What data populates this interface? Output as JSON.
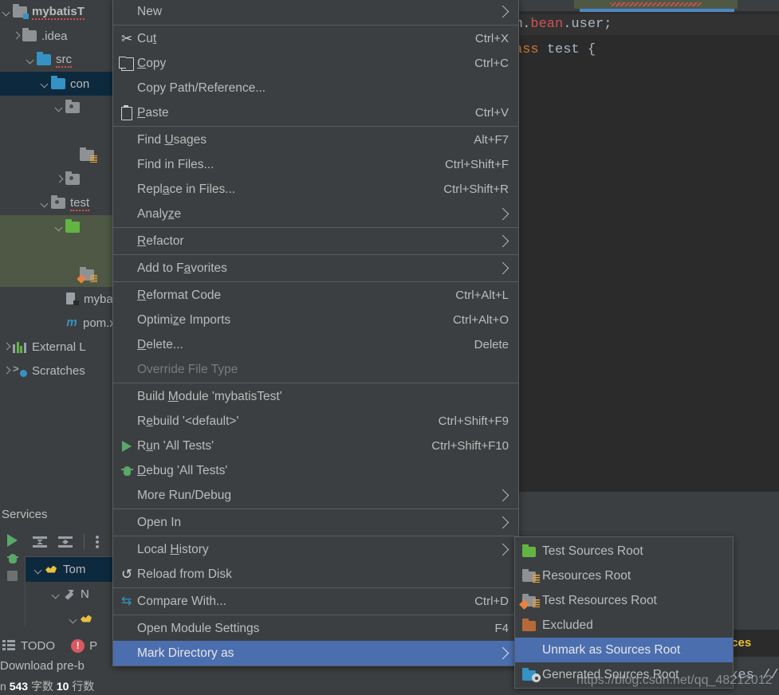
{
  "project_tree": {
    "items": [
      {
        "label": "mybatisT",
        "icon": "module-folder-icon",
        "indent": 0,
        "arrow": "down",
        "bold": true,
        "squiggle": true,
        "folder": "grey",
        "badge": "cyan",
        "state": "normal"
      },
      {
        "label": ".idea",
        "icon": "folder-icon",
        "indent": 1,
        "arrow": "right",
        "bold": false,
        "squiggle": false,
        "folder": "grey",
        "badge": "",
        "state": "normal"
      },
      {
        "label": "src",
        "icon": "folder-icon",
        "indent": 2,
        "arrow": "down",
        "bold": false,
        "squiggle": true,
        "folder": "blue",
        "badge": "",
        "state": "normal"
      },
      {
        "label": "con",
        "icon": "folder-icon",
        "indent": 3,
        "arrow": "down",
        "bold": false,
        "squiggle": false,
        "folder": "blue",
        "badge": "",
        "state": "selected-blue"
      },
      {
        "label": "",
        "icon": "package-icon",
        "indent": 4,
        "arrow": "down",
        "bold": false,
        "squiggle": false,
        "folder": "grey-pkg",
        "badge": "",
        "state": "normal"
      },
      {
        "label": "",
        "icon": "class-icon",
        "indent": 5,
        "arrow": "none",
        "bold": false,
        "squiggle": false,
        "folder": "none",
        "badge": "",
        "state": "normal"
      },
      {
        "label": "",
        "icon": "resources-folder-icon",
        "indent": 5,
        "arrow": "none",
        "bold": false,
        "squiggle": false,
        "folder": "grey",
        "badge": "lines",
        "state": "normal"
      },
      {
        "label": "",
        "icon": "package-icon",
        "indent": 4,
        "arrow": "right",
        "bold": false,
        "squiggle": false,
        "folder": "grey-pkg",
        "badge": "",
        "state": "normal"
      },
      {
        "label": "test",
        "icon": "package-icon",
        "indent": 3,
        "arrow": "down",
        "bold": false,
        "squiggle": true,
        "folder": "grey-pkg",
        "badge": "",
        "state": "normal"
      },
      {
        "label": "",
        "icon": "test-sources-folder-icon",
        "indent": 4,
        "arrow": "down",
        "bold": false,
        "squiggle": false,
        "folder": "green",
        "badge": "",
        "state": "selected-green"
      },
      {
        "label": "",
        "icon": "class-icon",
        "indent": 5,
        "arrow": "none",
        "bold": false,
        "squiggle": false,
        "folder": "none",
        "badge": "",
        "state": "selected-green"
      },
      {
        "label": "",
        "icon": "test-resources-folder-icon",
        "indent": 5,
        "arrow": "none",
        "bold": false,
        "squiggle": false,
        "folder": "grey",
        "badge": "test-res",
        "state": "selected-green"
      },
      {
        "label": "mybat",
        "icon": "module-file-icon",
        "indent": 4,
        "arrow": "none",
        "bold": false,
        "squiggle": false,
        "folder": "none",
        "badge": "",
        "state": "normal"
      },
      {
        "label": "pom.x",
        "icon": "maven-icon",
        "indent": 4,
        "arrow": "none",
        "bold": false,
        "squiggle": false,
        "folder": "none",
        "badge": "",
        "state": "normal"
      },
      {
        "label": "External L",
        "icon": "library-icon",
        "indent": 0,
        "arrow": "right",
        "bold": false,
        "squiggle": false,
        "folder": "none",
        "badge": "",
        "state": "normal"
      },
      {
        "label": "Scratches",
        "icon": "scratches-icon",
        "indent": 0,
        "arrow": "right",
        "bold": false,
        "squiggle": false,
        "folder": "none",
        "badge": "",
        "state": "normal"
      }
    ]
  },
  "editor": {
    "lines": [
      {
        "segments": [
          {
            "text": "m.",
            "cls": "c-default"
          },
          {
            "text": "bean",
            "cls": "c-pkg"
          },
          {
            "text": ".",
            "cls": "c-default"
          },
          {
            "text": "user",
            "cls": "c-ident"
          },
          {
            "text": ";",
            "cls": "c-default"
          }
        ],
        "highlight": true
      },
      {
        "segments": [
          {
            "text": "ass ",
            "cls": "c-keyword"
          },
          {
            "text": "test ",
            "cls": "c-default"
          },
          {
            "text": "{",
            "cls": "c-default"
          }
        ],
        "highlight": false
      }
    ]
  },
  "context_menu": {
    "items": [
      {
        "label": "New",
        "mnemonic": "",
        "shortcut": "",
        "icon": "",
        "submenu": true,
        "disabled": false,
        "selected": false,
        "sep_after": true
      },
      {
        "label": "Cut",
        "mnemonic": "t",
        "shortcut": "Ctrl+X",
        "icon": "cut-icon",
        "submenu": false,
        "disabled": false,
        "selected": false,
        "sep_after": false
      },
      {
        "label": "Copy",
        "mnemonic": "C",
        "shortcut": "Ctrl+C",
        "icon": "copy-icon",
        "submenu": false,
        "disabled": false,
        "selected": false,
        "sep_after": false
      },
      {
        "label": "Copy Path/Reference...",
        "mnemonic": "",
        "shortcut": "",
        "icon": "",
        "submenu": false,
        "disabled": false,
        "selected": false,
        "sep_after": false
      },
      {
        "label": "Paste",
        "mnemonic": "P",
        "shortcut": "Ctrl+V",
        "icon": "paste-icon",
        "submenu": false,
        "disabled": false,
        "selected": false,
        "sep_after": true
      },
      {
        "label": "Find Usages",
        "mnemonic": "U",
        "shortcut": "Alt+F7",
        "icon": "",
        "submenu": false,
        "disabled": false,
        "selected": false,
        "sep_after": false
      },
      {
        "label": "Find in Files...",
        "mnemonic": "",
        "shortcut": "Ctrl+Shift+F",
        "icon": "",
        "submenu": false,
        "disabled": false,
        "selected": false,
        "sep_after": false
      },
      {
        "label": "Replace in Files...",
        "mnemonic": "a",
        "shortcut": "Ctrl+Shift+R",
        "icon": "",
        "submenu": false,
        "disabled": false,
        "selected": false,
        "sep_after": false
      },
      {
        "label": "Analyze",
        "mnemonic": "z",
        "shortcut": "",
        "icon": "",
        "submenu": true,
        "disabled": false,
        "selected": false,
        "sep_after": true
      },
      {
        "label": "Refactor",
        "mnemonic": "R",
        "shortcut": "",
        "icon": "",
        "submenu": true,
        "disabled": false,
        "selected": false,
        "sep_after": true
      },
      {
        "label": "Add to Favorites",
        "mnemonic": "a",
        "shortcut": "",
        "icon": "",
        "submenu": true,
        "disabled": false,
        "selected": false,
        "sep_after": true
      },
      {
        "label": "Reformat Code",
        "mnemonic": "R",
        "shortcut": "Ctrl+Alt+L",
        "icon": "",
        "submenu": false,
        "disabled": false,
        "selected": false,
        "sep_after": false
      },
      {
        "label": "Optimize Imports",
        "mnemonic": "z",
        "shortcut": "Ctrl+Alt+O",
        "icon": "",
        "submenu": false,
        "disabled": false,
        "selected": false,
        "sep_after": false
      },
      {
        "label": "Delete...",
        "mnemonic": "D",
        "shortcut": "Delete",
        "icon": "",
        "submenu": false,
        "disabled": false,
        "selected": false,
        "sep_after": false
      },
      {
        "label": "Override File Type",
        "mnemonic": "",
        "shortcut": "",
        "icon": "",
        "submenu": false,
        "disabled": true,
        "selected": false,
        "sep_after": true
      },
      {
        "label": "Build Module 'mybatisTest'",
        "mnemonic": "M",
        "shortcut": "",
        "icon": "",
        "submenu": false,
        "disabled": false,
        "selected": false,
        "sep_after": false
      },
      {
        "label": "Rebuild '<default>'",
        "mnemonic": "e",
        "shortcut": "Ctrl+Shift+F9",
        "icon": "",
        "submenu": false,
        "disabled": false,
        "selected": false,
        "sep_after": false
      },
      {
        "label": "Run 'All Tests'",
        "mnemonic": "u",
        "shortcut": "Ctrl+Shift+F10",
        "icon": "run-icon",
        "submenu": false,
        "disabled": false,
        "selected": false,
        "sep_after": false
      },
      {
        "label": "Debug 'All Tests'",
        "mnemonic": "D",
        "shortcut": "",
        "icon": "debug-icon",
        "submenu": false,
        "disabled": false,
        "selected": false,
        "sep_after": false
      },
      {
        "label": "More Run/Debug",
        "mnemonic": "",
        "shortcut": "",
        "icon": "",
        "submenu": true,
        "disabled": false,
        "selected": false,
        "sep_after": true
      },
      {
        "label": "Open In",
        "mnemonic": "",
        "shortcut": "",
        "icon": "",
        "submenu": true,
        "disabled": false,
        "selected": false,
        "sep_after": true
      },
      {
        "label": "Local History",
        "mnemonic": "H",
        "shortcut": "",
        "icon": "",
        "submenu": true,
        "disabled": false,
        "selected": false,
        "sep_after": false
      },
      {
        "label": "Reload from Disk",
        "mnemonic": "",
        "shortcut": "",
        "icon": "reload-icon",
        "submenu": false,
        "disabled": false,
        "selected": false,
        "sep_after": true
      },
      {
        "label": "Compare With...",
        "mnemonic": "",
        "shortcut": "Ctrl+D",
        "icon": "compare-icon",
        "submenu": false,
        "disabled": false,
        "selected": false,
        "sep_after": true
      },
      {
        "label": "Open Module Settings",
        "mnemonic": "",
        "shortcut": "F4",
        "icon": "",
        "submenu": false,
        "disabled": false,
        "selected": false,
        "sep_after": false
      },
      {
        "label": "Mark Directory as",
        "mnemonic": "",
        "shortcut": "",
        "icon": "",
        "submenu": true,
        "disabled": false,
        "selected": true,
        "sep_after": false
      }
    ]
  },
  "sub_menu": {
    "items": [
      {
        "label": "Test Sources Root",
        "icon": "test-sources-root-icon",
        "selected": false
      },
      {
        "label": "Resources Root",
        "icon": "resources-root-icon",
        "selected": false
      },
      {
        "label": "Test Resources Root",
        "icon": "test-resources-root-icon",
        "selected": false
      },
      {
        "label": "Excluded",
        "icon": "excluded-icon",
        "selected": false
      },
      {
        "label": "Unmark as Sources Root",
        "icon": "",
        "selected": true
      },
      {
        "label": "Generated Sources Root",
        "icon": "generated-sources-root-icon",
        "selected": false
      }
    ]
  },
  "services": {
    "title": "Services",
    "toolbar": {
      "run_label": "run-icon",
      "debug_label": "debug-icon",
      "stop_label": "stop-icon",
      "expand_all_label": "expand-all-icon",
      "collapse_all_label": "collapse-all-icon",
      "more_label": "more-options-icon"
    },
    "tree": [
      {
        "label": "Tom",
        "icon": "tomcat-icon",
        "indent": 0,
        "arrow": "down",
        "selected": true
      },
      {
        "label": "N",
        "icon": "wrench-icon",
        "indent": 1,
        "arrow": "down",
        "selected": false
      },
      {
        "label": "",
        "icon": "tomcat-icon",
        "indent": 2,
        "arrow": "down",
        "selected": false
      }
    ]
  },
  "bottom_bar": {
    "todo_label": "TODO",
    "problems_label": "P",
    "services_tab_label": "ices"
  },
  "status_bar": {
    "message": "Download pre-b",
    "counts_prefix": "n",
    "char_count": "543",
    "char_unit": "字数",
    "line_count": "10",
    "line_unit": "行数"
  },
  "editor_fragment": {
    "code_tail": "exes // A"
  },
  "watermark": {
    "text": "https://blog.csdn.net/qq_48212012"
  },
  "colors": {
    "menu_bg": "#3c3f41",
    "menu_border": "#5a5d5e",
    "highlight": "#4b6eaf",
    "editor_bg": "#2b2b2b",
    "tree_selected_blue": "#0d293e",
    "tree_selected_green": "#4e5845",
    "text": "#bbbbbb",
    "accent_green": "#62b543",
    "accent_orange": "#b8693a",
    "accent_blue": "#3592c4",
    "error_red": "#db5860"
  }
}
